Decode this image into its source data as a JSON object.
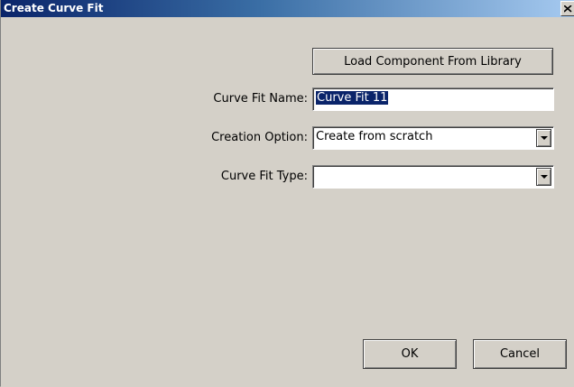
{
  "window": {
    "title": "Create Curve Fit",
    "close_icon": "close-icon"
  },
  "toolbar": {
    "load_library_label": "Load Component From Library"
  },
  "form": {
    "name_label": "Curve Fit Name:",
    "name_value": "Curve Fit 11",
    "creation_label": "Creation Option:",
    "creation_value": "Create from scratch",
    "type_label": "Curve Fit Type:",
    "type_value": ""
  },
  "actions": {
    "ok_label": "OK",
    "cancel_label": "Cancel"
  },
  "colors": {
    "title_bar_start": "#0a246a",
    "title_bar_end": "#a6caf0",
    "dialog_face": "#d4d0c8",
    "selection": "#0a246a"
  }
}
